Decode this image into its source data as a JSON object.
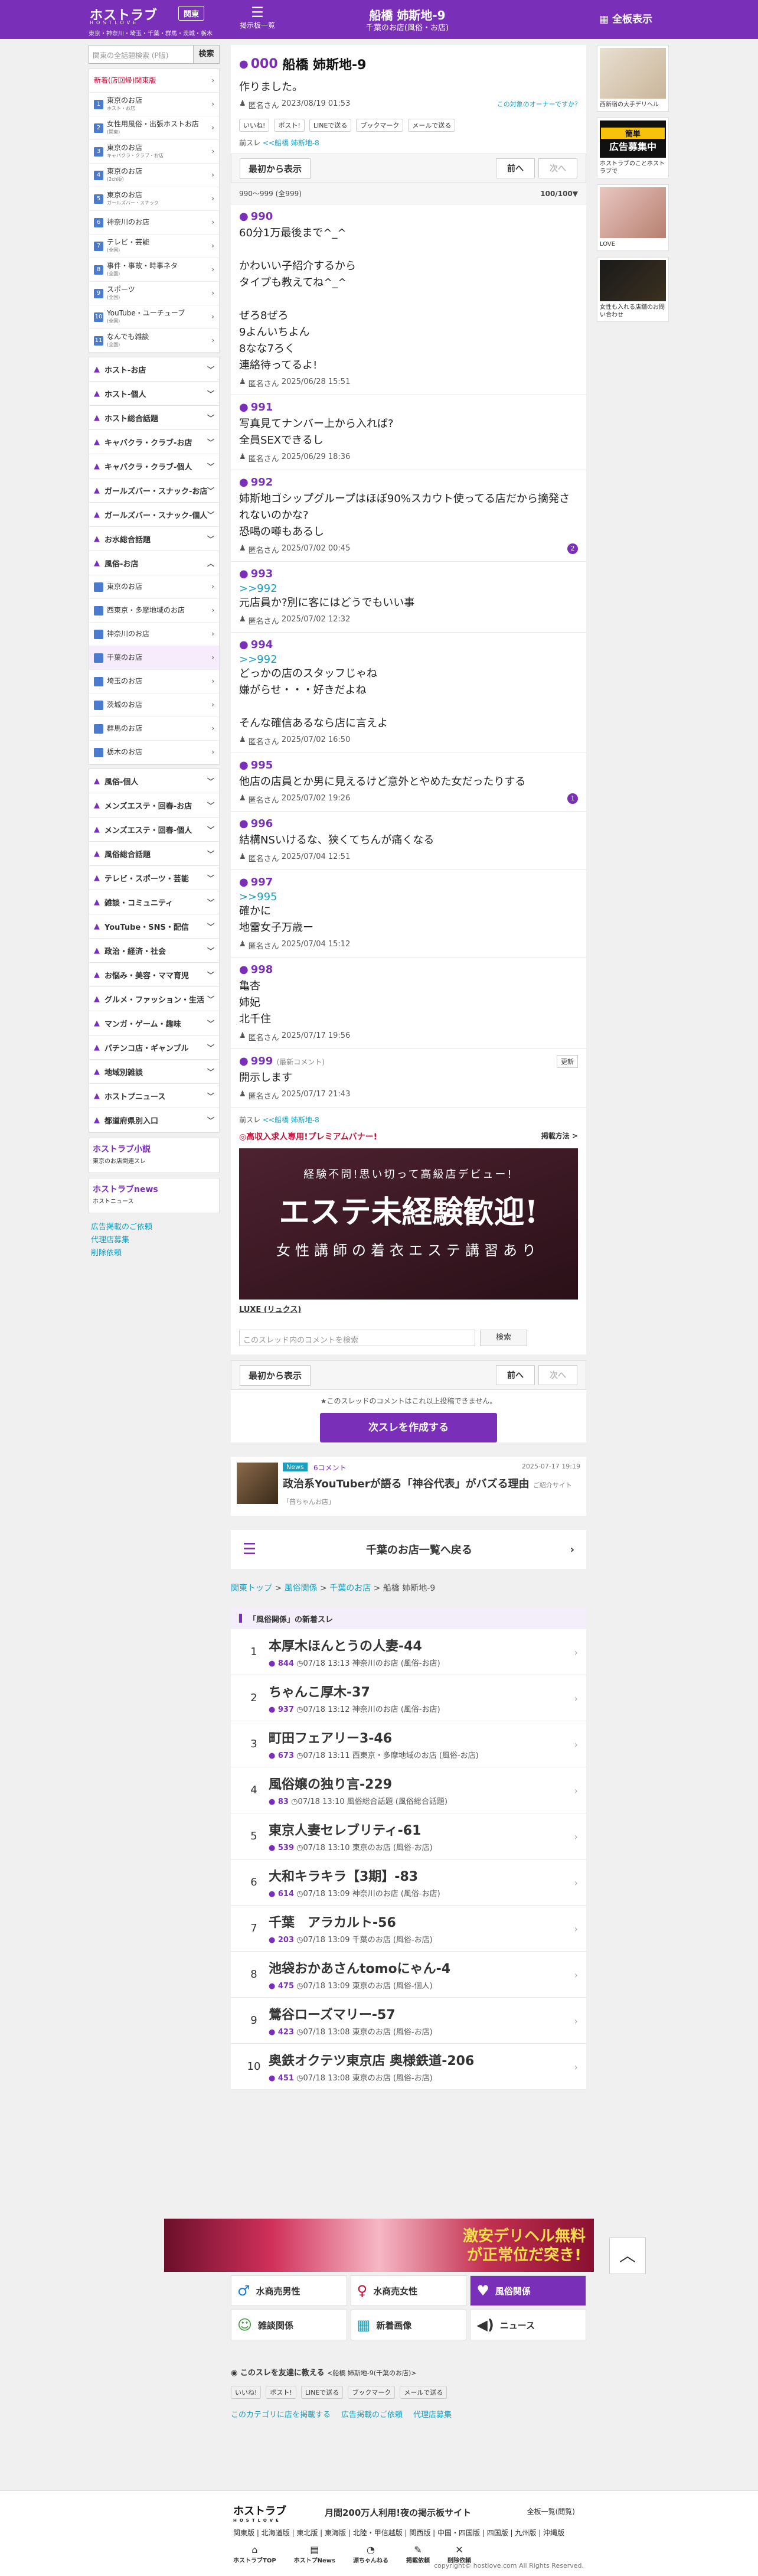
{
  "header": {
    "logo": "ホストラブ",
    "logo_sub": "HOSTLOVE",
    "region": "東京・神奈川・埼玉・千葉・群馬・茨城・栃木",
    "area_button": "関東",
    "board_list": "掲示板一覧",
    "title": "船橋 姉斯地-9",
    "subtitle": "千葉のお店(風俗・お店)",
    "all_boards": "全板表示"
  },
  "sidebar": {
    "search_placeholder": "関東の全話題検索 (P版)",
    "search_button": "検索",
    "top_items": [
      {
        "num": "",
        "label": "新着(店回帰)関東版",
        "note": ""
      },
      {
        "num": "1",
        "label": "東京のお店",
        "note": "ホスト・お店"
      },
      {
        "num": "2",
        "label": "女性用風俗・出張ホストお店",
        "note": "(関東)"
      },
      {
        "num": "3",
        "label": "東京のお店",
        "note": "キャバクラ・クラブ・お店"
      },
      {
        "num": "4",
        "label": "東京のお店",
        "note": "(2ch版)"
      },
      {
        "num": "5",
        "label": "東京のお店",
        "note": "ガールズバー・スナック"
      },
      {
        "num": "6",
        "label": "神奈川のお店",
        "note": ""
      },
      {
        "num": "7",
        "label": "テレビ・芸能",
        "note": "(全国)"
      },
      {
        "num": "8",
        "label": "事件・事故・時事ネタ",
        "note": "(全国)"
      },
      {
        "num": "9",
        "label": "スポーツ",
        "note": "(全国)"
      },
      {
        "num": "10",
        "label": "YouTube・ユーチューブ",
        "note": "(全国)"
      },
      {
        "num": "11",
        "label": "なんでも雑談",
        "note": "(全国)"
      }
    ],
    "categories": [
      "ホスト-お店",
      "ホスト-個人",
      "ホスト総合話題",
      "キャバクラ・クラブ-お店",
      "キャバクラ・クラブ-個人",
      "ガールズバー・スナック-お店",
      "ガールズバー・スナック-個人",
      "お水総合話題",
      "風俗-お店"
    ],
    "fuzoku_subs": [
      "東京のお店",
      "西東京・多摩地域のお店",
      "神奈川のお店",
      "千葉のお店",
      "埼玉のお店",
      "茨城のお店",
      "群馬のお店",
      "栃木のお店"
    ],
    "categories2": [
      "風俗-個人",
      "メンズエステ・回春-お店",
      "メンズエステ・回春-個人",
      "風俗総合話題",
      "テレビ・スポーツ・芸能",
      "雑談・コミュニティ",
      "YouTube・SNS・配信",
      "政治・経済・社会",
      "お悩み・美容・ママ育児",
      "グルメ・ファッション・生活",
      "マンガ・ゲーム・趣味",
      "パチンコ店・ギャンブル",
      "地域別雑談",
      "ホストプニュース",
      "都道府県別入口"
    ],
    "banners": [
      {
        "label": "ホストラブ小説",
        "note": "東京のお店関連スレ"
      },
      {
        "label": "ホストラブnews",
        "note": "ホストニュース"
      }
    ],
    "links": [
      "広告掲載のご依頼",
      "代理店募集",
      "削除依頼"
    ]
  },
  "right": [
    {
      "text": "西新宿の大手デリヘル"
    },
    {
      "ad_title": "広告募集中",
      "ad_badge": "簡単",
      "text": "ホストラブのことホストラブで"
    },
    {
      "text": "LOVE"
    },
    {
      "text": "女性も入れる店舗のお問い合わせ"
    }
  ],
  "thread": {
    "num": "000",
    "title": "船橋 姉斯地-9",
    "body": "作りました。",
    "author": "匿名さん",
    "date": "2023/08/19 01:53",
    "owner_link": "この対象のオーナーですか?",
    "share": [
      "いいね!",
      "ポスト!",
      "LINEで送る",
      "ブックマーク",
      "メールで送る"
    ],
    "prev_label": "前スレ",
    "prev": "<<船橋 姉斯地-8"
  },
  "nav": {
    "latest": "最初から表示",
    "prev": "前へ",
    "next": "次へ",
    "range": "990〜999 (全999)",
    "range_right": "100/100▼"
  },
  "posts": [
    {
      "num": "990",
      "reply": "",
      "body": "60分1万最後まで^_^\n\nかわいい子紹介するから\nタイプも教えてね^_^\n\nぜろ8ぜろ\n9よんいちよん\n8なな7ろく\n連絡待ってるよ!",
      "author": "匿名さん",
      "date": "2025/06/28 15:51",
      "count": ""
    },
    {
      "num": "991",
      "reply": "",
      "body": "写真見てナンバー上から入れば?\n全員SEXできるし",
      "author": "匿名さん",
      "date": "2025/06/29 18:36",
      "count": ""
    },
    {
      "num": "992",
      "reply": "",
      "body": "姉斯地ゴシップグループはほぼ90%スカウト使ってる店だから摘発されないのかな?\n恐喝の噂もあるし",
      "author": "匿名さん",
      "date": "2025/07/02 00:45",
      "count": "2"
    },
    {
      "num": "993",
      "reply": ">>992",
      "body": "元店員か?別に客にはどうでもいい事",
      "author": "匿名さん",
      "date": "2025/07/02 12:32",
      "count": ""
    },
    {
      "num": "994",
      "reply": ">>992",
      "body": "どっかの店のスタッフじゃね\n嫌がらせ・・・好きだよね\n\nそんな確信あるなら店に言えよ",
      "author": "匿名さん",
      "date": "2025/07/02 16:50",
      "count": ""
    },
    {
      "num": "995",
      "reply": "",
      "body": "他店の店員とか男に見えるけど意外とやめた女だったりする",
      "author": "匿名さん",
      "date": "2025/07/02 19:26",
      "count": "1"
    },
    {
      "num": "996",
      "reply": "",
      "body": "結構NSいけるな、狭くてちんが痛くなる",
      "author": "匿名さん",
      "date": "2025/07/04 12:51",
      "count": ""
    },
    {
      "num": "997",
      "reply": ">>995",
      "body": "確かに\n地雷女子万歳ー",
      "author": "匿名さん",
      "date": "2025/07/04 15:12",
      "count": ""
    },
    {
      "num": "998",
      "reply": "",
      "body": "亀杏\n姉妃\n北千住",
      "author": "匿名さん",
      "date": "2025/07/17 19:56",
      "count": ""
    },
    {
      "num": "999",
      "reply": "",
      "body": "開示します",
      "author": "匿名さん",
      "date": "2025/07/17 21:43",
      "count": "",
      "newest": "(最新コメント)",
      "update": "更新"
    }
  ],
  "after": {
    "prev": "<<船橋 姉斯地-8",
    "premium": "◎高収入求人専用!プレミアムバナー!",
    "premium_right": "掲載方法 >",
    "ad_line1": "経験不問!思い切って高級店デビュー!",
    "ad_line2": "エステ未経験歓迎!",
    "ad_line3": "女性講師の着衣エステ講習あり",
    "ad_caption": "LUXE (リュクス)",
    "search_placeholder": "このスレッド内のコメントを検索",
    "search_button": "検索",
    "note": "★このスレッドのコメントはこれ以上投稿できません。",
    "new_thread": "次スレを作成する"
  },
  "news": {
    "tag": "News",
    "comments": "6コメント",
    "date": "2025-07-17 19:19",
    "headline": "政治系YouTuberが語る「神谷代表」がバズる理由",
    "source": "ご紹介サイト「普ちゃんお店」"
  },
  "back": "千葉のお店一覧へ戻る",
  "breadcrumb": [
    "関東トップ",
    "風俗関係",
    "千葉のお店",
    "船橋 姉斯地-9"
  ],
  "newlist": {
    "header": "「風俗関係」の新着スレ",
    "items": [
      {
        "t": "本厚木ほんとうの人妻-44",
        "c": "844",
        "d": "07/18 13:13",
        "b": "神奈川のお店 (風俗-お店)"
      },
      {
        "t": "ちゃんこ厚木-37",
        "c": "937",
        "d": "07/18 13:12",
        "b": "神奈川のお店 (風俗-お店)"
      },
      {
        "t": "町田フェアリー3-46",
        "c": "673",
        "d": "07/18 13:11",
        "b": "西東京・多摩地域のお店 (風俗-お店)"
      },
      {
        "t": "風俗嬢の独り言-229",
        "c": "83",
        "d": "07/18 13:10",
        "b": "風俗総合話題 (風俗総合話題)"
      },
      {
        "t": "東京人妻セレブリティ-61",
        "c": "539",
        "d": "07/18 13:10",
        "b": "東京のお店 (風俗-お店)"
      },
      {
        "t": "大和キラキラ【3期】-83",
        "c": "614",
        "d": "07/18 13:09",
        "b": "神奈川のお店 (風俗-お店)"
      },
      {
        "t": "千葉　アラカルト-56",
        "c": "203",
        "d": "07/18 13:09",
        "b": "千葉のお店 (風俗-お店)"
      },
      {
        "t": "池袋おかあさんtomoにゃん-4",
        "c": "475",
        "d": "07/18 13:09",
        "b": "東京のお店 (風俗-個人)"
      },
      {
        "t": "鶯谷ローズマリー-57",
        "c": "423",
        "d": "07/18 13:08",
        "b": "東京のお店 (風俗-お店)"
      },
      {
        "t": "奥鉄オクテツ東京店 奥様鉄道-206",
        "c": "451",
        "d": "07/18 13:08",
        "b": "東京のお店 (風俗-お店)"
      }
    ]
  },
  "adstrip": "激安デリヘル無料が正常位だ突き!",
  "tiles": [
    {
      "icon": "♂",
      "label": "水商売男性",
      "color": "#1a7fd0"
    },
    {
      "icon": "♀",
      "label": "水商売女性",
      "color": "#c0143c"
    },
    {
      "icon": "♥",
      "label": "風俗関係",
      "color": "#fff"
    },
    {
      "icon": "☺",
      "label": "雑談関係",
      "color": "#3a9a3a"
    },
    {
      "icon": "▦",
      "label": "新着画像",
      "color": "#1a9fbf"
    },
    {
      "icon": "◀)",
      "label": "ニュース",
      "color": "#333"
    }
  ],
  "share_bottom": {
    "title": "このスレを友達に教える",
    "note": "<船橋 姉斯地-9(千葉のお店)>",
    "buttons": [
      "いいね!",
      "ポスト!",
      "LINEで送る",
      "ブックマーク",
      "メールで送る"
    ],
    "links": [
      "このカテゴリに店を掲載する",
      "広告掲載のご依頼",
      "代理店募集"
    ]
  },
  "footer": {
    "logo": "ホストラブ",
    "logo_sub": "HOSTLOVE",
    "tagline": "月間200万人利用!夜の掲示板サイト",
    "all": "全板一覧(閲覧)",
    "regions": "関東版 | 北海道版 | 東北版 | 東海版 | 北陸・甲信越版 | 関西版 | 中国・四国版 | 四国版 | 九州版 | 沖縄版",
    "bottom": [
      "ホストラブTOP",
      "ホストプNews",
      "源ちゃんねる",
      "掲載依頼",
      "削除依頼"
    ],
    "copyright": "copyright© hostlove.com All Rights Reserved."
  }
}
